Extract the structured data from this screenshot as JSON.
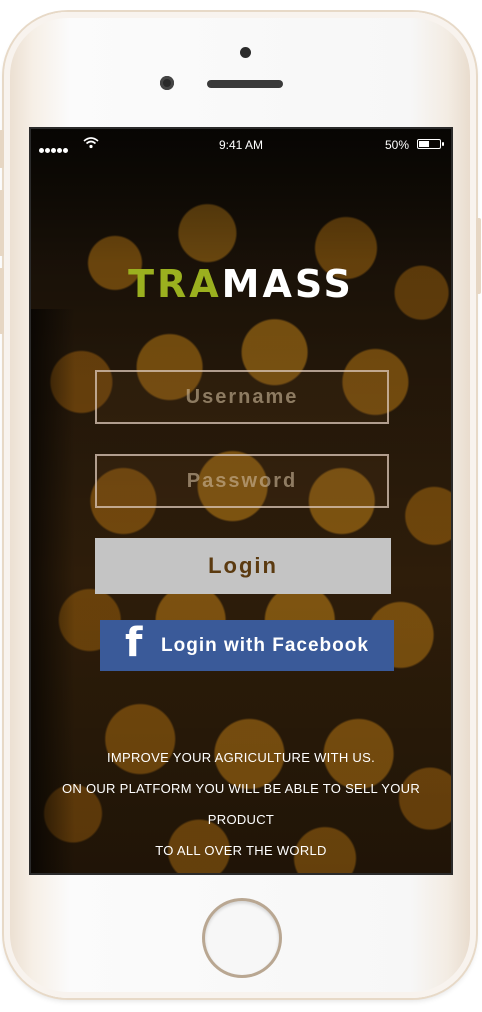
{
  "status_bar": {
    "time": "9:41 AM",
    "battery": "50%",
    "battery_level": 0.5
  },
  "app": {
    "logo_part1": "TRA",
    "logo_part2": "MASS"
  },
  "form": {
    "username_placeholder": "Username",
    "password_placeholder": "Password",
    "login_label": "Login",
    "facebook_label": "Login with Facebook"
  },
  "tagline": {
    "line1": "IMPROVE YOUR AGRICULTURE WITH US.",
    "line2": "ON OUR PLATFORM YOU WILL BE ABLE TO SELL YOUR PRODUCT",
    "line3": "TO ALL OVER THE WORLD"
  },
  "icons": {
    "signal": "signal-dots-icon",
    "wifi": "wifi-icon",
    "battery": "battery-icon",
    "facebook": "facebook-icon"
  },
  "colors": {
    "logo_green": "#9bb01f",
    "facebook_blue": "#3a5a99",
    "login_button_bg": "#c4c4c4",
    "login_text": "#5b3a10"
  }
}
